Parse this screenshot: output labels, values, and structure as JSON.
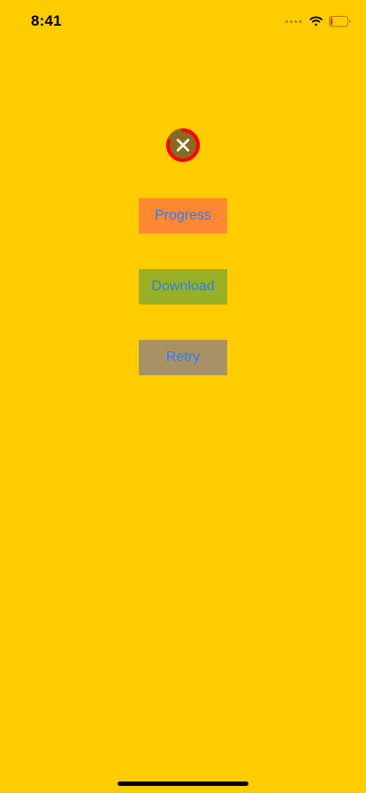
{
  "status_bar": {
    "time": "8:41",
    "signal_icon": "signal-dots-icon",
    "wifi_icon": "wifi-icon",
    "battery_icon": "battery-low-icon",
    "battery_level": 0.12,
    "battery_color": "#E3261F"
  },
  "progress": {
    "icon": "close-icon",
    "value": 0.8,
    "ring_color": "#FF0000",
    "track_color": "#8A6A20",
    "fill_color": "#8A6A20",
    "icon_color": "#FFFFFF"
  },
  "buttons": [
    {
      "label": "Progress",
      "color": "#FF8833"
    },
    {
      "label": "Download",
      "color": "#98B026"
    },
    {
      "label": "Retry",
      "color": "#A89265"
    }
  ],
  "theme": {
    "background": "#FFCC00",
    "button_text_color": "#2D7CF6"
  }
}
